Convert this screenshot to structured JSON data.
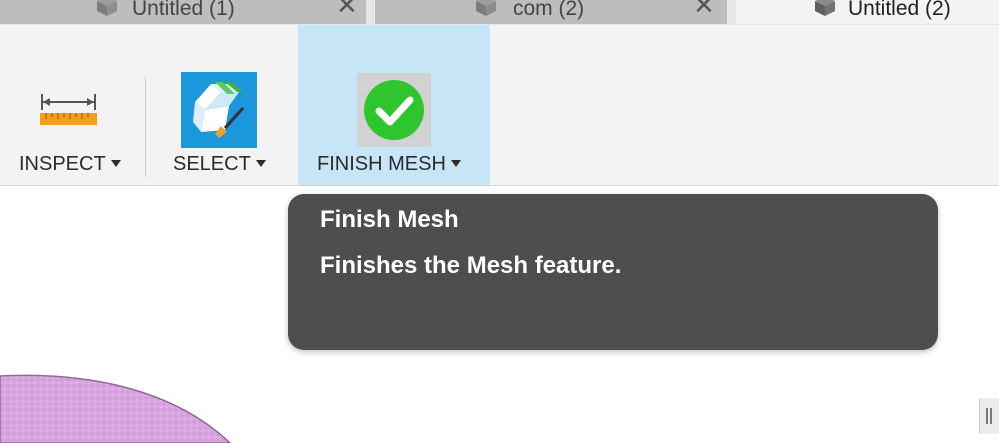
{
  "tabs": [
    {
      "label": "Untitled (1)",
      "close": "✕",
      "active": false
    },
    {
      "label": "com (2)",
      "close": "✕",
      "active": false
    },
    {
      "label": "Untitled (2)",
      "active": true
    }
  ],
  "toolbar": {
    "inspect": {
      "label": "INSPECT",
      "icon": "ruler-measure-icon"
    },
    "select": {
      "label": "SELECT",
      "icon": "select-paintbrush-icon"
    },
    "finish_mesh": {
      "label": "FINISH MESH",
      "icon": "green-checkmark-icon",
      "highlighted": true
    }
  },
  "tooltip": {
    "title": "Finish Mesh",
    "description": "Finishes the Mesh feature."
  },
  "colors": {
    "toolbar_bg": "#f3f3f3",
    "highlight": "#c6e6f7",
    "tooltip_bg": "#4e4e4e",
    "check_green": "#2ec52e",
    "select_blue": "#1a98db",
    "mesh_pink": "#d9a6e0"
  }
}
